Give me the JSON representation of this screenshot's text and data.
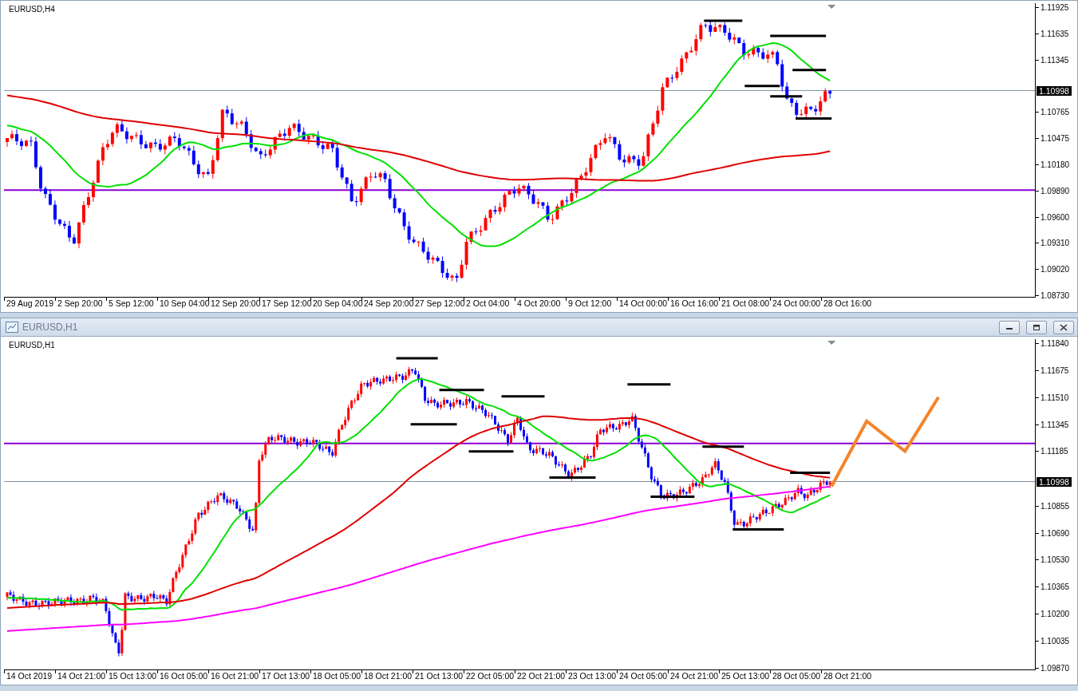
{
  "charts": [
    {
      "symbol_label": "EURUSD,H4",
      "price_labels": [
        "1.11925",
        "1.11635",
        "1.11345",
        "1.10765",
        "1.10475",
        "1.10180",
        "1.09890",
        "1.09600",
        "1.09310",
        "1.09020",
        "1.08730"
      ],
      "current_price": "1.10998",
      "time_labels": [
        "29 Aug 2019",
        "2 Sep 20:00",
        "5 Sep 12:00",
        "10 Sep 04:00",
        "12 Sep 20:00",
        "17 Sep 12:00",
        "20 Sep 04:00",
        "24 Sep 20:00",
        "27 Sep 12:00",
        "2 Oct 04:00",
        "4 Oct 20:00",
        "9 Oct 12:00",
        "14 Oct 00:00",
        "16 Oct 16:00",
        "21 Oct 08:00",
        "24 Oct 00:00",
        "28 Oct 16:00"
      ]
    },
    {
      "window_title": "EURUSD,H1",
      "symbol_label": "EURUSD,H1",
      "price_labels": [
        "1.11840",
        "1.11675",
        "1.11510",
        "1.11345",
        "1.11185",
        "1.10855",
        "1.10690",
        "1.10530",
        "1.10365",
        "1.10200",
        "1.10035",
        "1.09870"
      ],
      "current_price": "1.10998",
      "time_labels": [
        "14 Oct 2019",
        "14 Oct 21:00",
        "15 Oct 13:00",
        "16 Oct 05:00",
        "16 Oct 21:00",
        "17 Oct 13:00",
        "18 Oct 05:00",
        "18 Oct 21:00",
        "21 Oct 13:00",
        "22 Oct 05:00",
        "22 Oct 21:00",
        "23 Oct 13:00",
        "24 Oct 05:00",
        "24 Oct 21:00",
        "25 Oct 13:00",
        "28 Oct 05:00",
        "28 Oct 21:00"
      ]
    }
  ]
}
